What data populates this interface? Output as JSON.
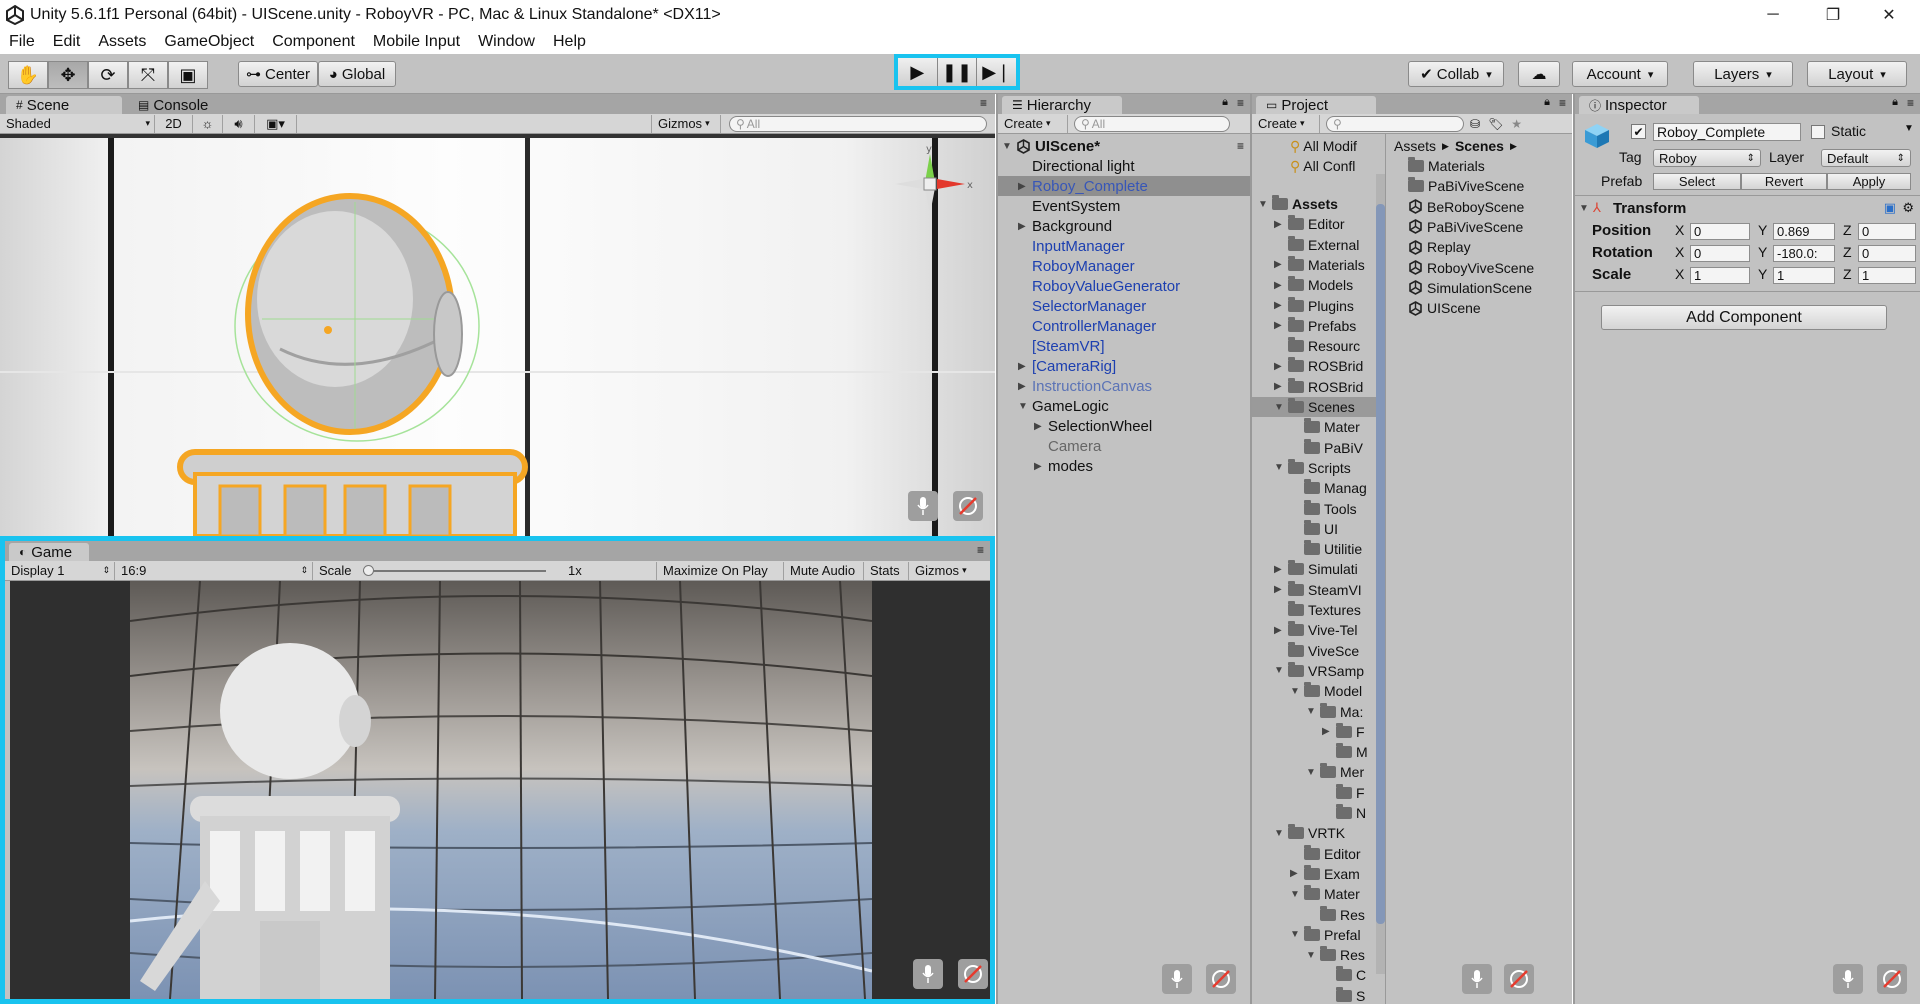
{
  "window": {
    "title": "Unity 5.6.1f1 Personal (64bit) - UIScene.unity - RoboyVR - PC, Mac & Linux Standalone* <DX11>",
    "minimize": "─",
    "maximize": "❐",
    "close": "✕"
  },
  "menu": [
    "File",
    "Edit",
    "Assets",
    "GameObject",
    "Component",
    "Mobile Input",
    "Window",
    "Help"
  ],
  "toolbar": {
    "pivot": "Center",
    "space": "Global",
    "collab": "Collab",
    "account": "Account",
    "layers": "Layers",
    "layout": "Layout",
    "play_highlight_color": "#19c3ef"
  },
  "scene": {
    "tab_scene": "Scene",
    "tab_console": "Console",
    "shading": "Shaded",
    "mode2d": "2D",
    "gizmos": "Gizmos",
    "search_placeholder": "All",
    "gizmo_y": "y",
    "gizmo_x": "x",
    "selection_color": "#f5a623"
  },
  "game": {
    "tab": "Game",
    "display": "Display 1",
    "aspect": "16:9",
    "scale_label": "Scale",
    "scale_value": "1x",
    "maximize": "Maximize On Play",
    "mute": "Mute Audio",
    "stats": "Stats",
    "gizmos": "Gizmos"
  },
  "hierarchy": {
    "tab": "Hierarchy",
    "create": "Create",
    "search_placeholder": "All",
    "scene_name": "UIScene*",
    "items": [
      {
        "label": "Directional light",
        "style": "normal",
        "arrow": ""
      },
      {
        "label": "Roboy_Complete",
        "style": "selected",
        "arrow": "▶"
      },
      {
        "label": "EventSystem",
        "style": "normal",
        "arrow": ""
      },
      {
        "label": "Background",
        "style": "normal",
        "arrow": "▶"
      },
      {
        "label": "InputManager",
        "style": "blue",
        "arrow": ""
      },
      {
        "label": "RoboyManager",
        "style": "blue",
        "arrow": ""
      },
      {
        "label": "RoboyValueGenerator",
        "style": "blue",
        "arrow": ""
      },
      {
        "label": "SelectorManager",
        "style": "blue",
        "arrow": ""
      },
      {
        "label": "ControllerManager",
        "style": "blue",
        "arrow": ""
      },
      {
        "label": "[SteamVR]",
        "style": "blue",
        "arrow": ""
      },
      {
        "label": "[CameraRig]",
        "style": "blue",
        "arrow": "▶"
      },
      {
        "label": "InstructionCanvas",
        "style": "faded",
        "arrow": "▶"
      },
      {
        "label": "GameLogic",
        "style": "normal",
        "arrow": "▼"
      },
      {
        "label": "SelectionWheel",
        "style": "normal",
        "arrow": "▶",
        "indent": 1
      },
      {
        "label": "Camera",
        "style": "gray",
        "arrow": "",
        "indent": 1
      },
      {
        "label": "modes",
        "style": "normal",
        "arrow": "▶",
        "indent": 1
      }
    ]
  },
  "project": {
    "tab": "Project",
    "create": "Create",
    "favorites": [
      "All Modif",
      "All Confl"
    ],
    "tree": [
      {
        "label": "Assets",
        "arrow": "▼",
        "bold": true,
        "indent": 0
      },
      {
        "label": "Editor",
        "arrow": "▶",
        "indent": 1
      },
      {
        "label": "External",
        "arrow": "",
        "indent": 1
      },
      {
        "label": "Materials",
        "arrow": "▶",
        "indent": 1
      },
      {
        "label": "Models",
        "arrow": "▶",
        "indent": 1
      },
      {
        "label": "Plugins",
        "arrow": "▶",
        "indent": 1
      },
      {
        "label": "Prefabs",
        "arrow": "▶",
        "indent": 1
      },
      {
        "label": "Resourc",
        "arrow": "",
        "indent": 1
      },
      {
        "label": "ROSBrid",
        "arrow": "▶",
        "indent": 1
      },
      {
        "label": "ROSBrid",
        "arrow": "▶",
        "indent": 1
      },
      {
        "label": "Scenes",
        "arrow": "▼",
        "indent": 1,
        "selected": true
      },
      {
        "label": "Mater",
        "arrow": "",
        "indent": 2
      },
      {
        "label": "PaBiV",
        "arrow": "",
        "indent": 2
      },
      {
        "label": "Scripts",
        "arrow": "▼",
        "indent": 1
      },
      {
        "label": "Manag",
        "arrow": "",
        "indent": 2
      },
      {
        "label": "Tools",
        "arrow": "",
        "indent": 2
      },
      {
        "label": "UI",
        "arrow": "",
        "indent": 2
      },
      {
        "label": "Utilitie",
        "arrow": "",
        "indent": 2
      },
      {
        "label": "Simulati",
        "arrow": "▶",
        "indent": 1
      },
      {
        "label": "SteamVI",
        "arrow": "▶",
        "indent": 1
      },
      {
        "label": "Textures",
        "arrow": "",
        "indent": 1
      },
      {
        "label": "Vive-Tel",
        "arrow": "▶",
        "indent": 1
      },
      {
        "label": "ViveSce",
        "arrow": "",
        "indent": 1
      },
      {
        "label": "VRSamp",
        "arrow": "▼",
        "indent": 1
      },
      {
        "label": "Model",
        "arrow": "▼",
        "indent": 2
      },
      {
        "label": "Ma:",
        "arrow": "▼",
        "indent": 3
      },
      {
        "label": "F",
        "arrow": "▶",
        "indent": 4
      },
      {
        "label": "M",
        "arrow": "",
        "indent": 4
      },
      {
        "label": "Mer",
        "arrow": "▼",
        "indent": 3
      },
      {
        "label": "F",
        "arrow": "",
        "indent": 4
      },
      {
        "label": "N",
        "arrow": "",
        "indent": 4
      },
      {
        "label": "VRTK",
        "arrow": "▼",
        "indent": 1
      },
      {
        "label": "Editor",
        "arrow": "",
        "indent": 2
      },
      {
        "label": "Exam",
        "arrow": "▶",
        "indent": 2
      },
      {
        "label": "Mater",
        "arrow": "▼",
        "indent": 2
      },
      {
        "label": "Res",
        "arrow": "",
        "indent": 3
      },
      {
        "label": "Prefal",
        "arrow": "▼",
        "indent": 2
      },
      {
        "label": "Res",
        "arrow": "▼",
        "indent": 3
      },
      {
        "label": "C",
        "arrow": "",
        "indent": 4
      },
      {
        "label": "S",
        "arrow": "",
        "indent": 4
      }
    ],
    "breadcrumb_root": "Assets",
    "breadcrumb_current": "Scenes",
    "files": [
      {
        "label": "Materials",
        "type": "folder"
      },
      {
        "label": "PaBiViveScene",
        "type": "folder"
      },
      {
        "label": "BeRoboyScene",
        "type": "scene"
      },
      {
        "label": "PaBiViveScene",
        "type": "scene"
      },
      {
        "label": "Replay",
        "type": "scene"
      },
      {
        "label": "RoboyViveScene",
        "type": "scene"
      },
      {
        "label": "SimulationScene",
        "type": "scene"
      },
      {
        "label": "UIScene",
        "type": "scene"
      }
    ]
  },
  "inspector": {
    "tab": "Inspector",
    "object_name": "Roboy_Complete",
    "static_label": "Static",
    "tag_label": "Tag",
    "tag_value": "Roboy",
    "layer_label": "Layer",
    "layer_value": "Default",
    "prefab_label": "Prefab",
    "prefab_select": "Select",
    "prefab_revert": "Revert",
    "prefab_apply": "Apply",
    "transform_title": "Transform",
    "position_label": "Position",
    "rotation_label": "Rotation",
    "scale_label": "Scale",
    "axis_x": "X",
    "axis_y": "Y",
    "axis_z": "Z",
    "position": {
      "x": "0",
      "y": "0.869",
      "z": "0"
    },
    "rotation": {
      "x": "0",
      "y": "-180.0:",
      "z": "0"
    },
    "scale": {
      "x": "1",
      "y": "1",
      "z": "1"
    },
    "add_component": "Add Component"
  }
}
